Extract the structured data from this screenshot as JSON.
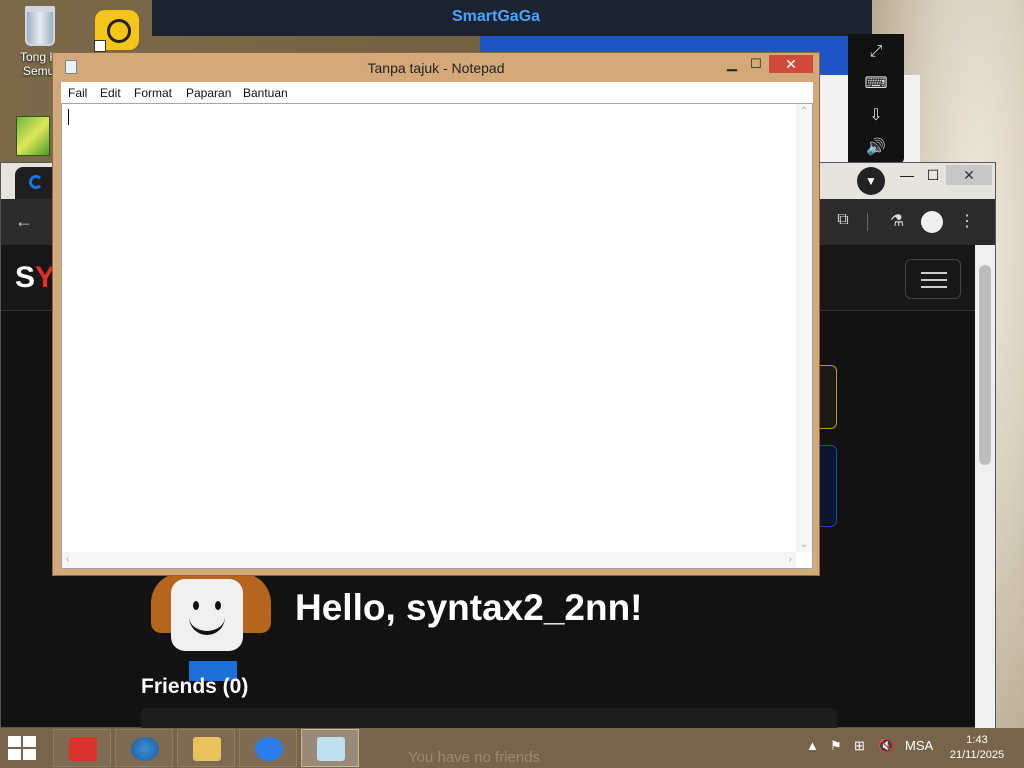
{
  "desktop": {
    "recycle_bin_label": "Tong Ki\nSemul",
    "smartgaga_brand": "SmartGaGa"
  },
  "browser": {
    "site_logo_white": "S",
    "site_logo_red": "Y",
    "greeting": "Hello, syntax2_2nn!",
    "friends_heading": "Friends (0)",
    "no_friends_text": "You have no friends"
  },
  "notepad": {
    "title": "Tanpa tajuk - Notepad",
    "menu": [
      "Fail",
      "Edit",
      "Format",
      "Paparan",
      "Bantuan"
    ],
    "content": ""
  },
  "taskbar": {
    "language": "MSA",
    "time": "1:43",
    "date": "21/11/2025"
  },
  "colors": {
    "notepad_frame": "#d4a97a",
    "close_red": "#d04a3c",
    "site_bg": "#121212",
    "taskbar": "#77644a"
  }
}
